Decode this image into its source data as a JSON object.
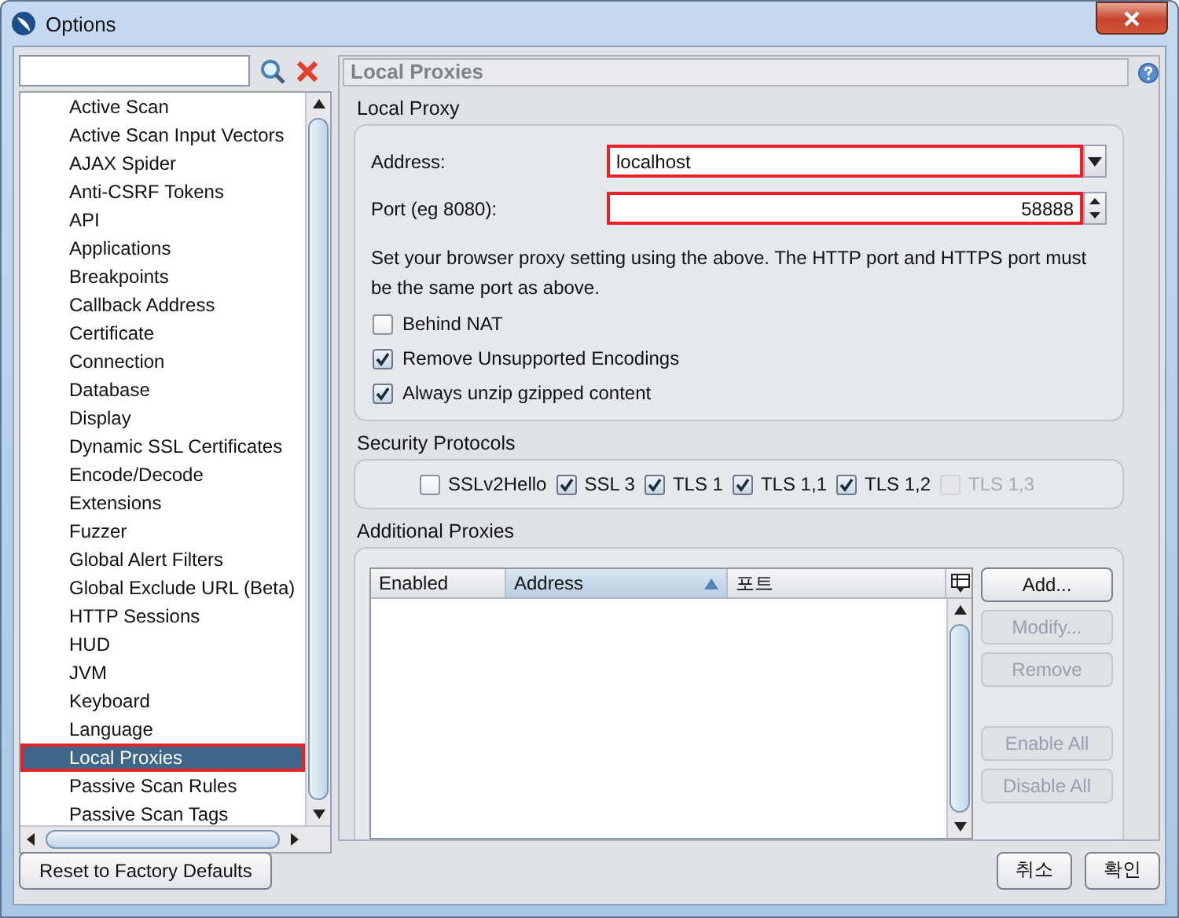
{
  "window": {
    "title": "Options"
  },
  "sidebar": {
    "items": [
      {
        "label": "Active Scan",
        "selected": false
      },
      {
        "label": "Active Scan Input Vectors",
        "selected": false
      },
      {
        "label": "AJAX Spider",
        "selected": false
      },
      {
        "label": "Anti-CSRF Tokens",
        "selected": false
      },
      {
        "label": "API",
        "selected": false
      },
      {
        "label": "Applications",
        "selected": false
      },
      {
        "label": "Breakpoints",
        "selected": false
      },
      {
        "label": "Callback Address",
        "selected": false
      },
      {
        "label": "Certificate",
        "selected": false
      },
      {
        "label": "Connection",
        "selected": false
      },
      {
        "label": "Database",
        "selected": false
      },
      {
        "label": "Display",
        "selected": false
      },
      {
        "label": "Dynamic SSL Certificates",
        "selected": false
      },
      {
        "label": "Encode/Decode",
        "selected": false
      },
      {
        "label": "Extensions",
        "selected": false
      },
      {
        "label": "Fuzzer",
        "selected": false
      },
      {
        "label": "Global Alert Filters",
        "selected": false
      },
      {
        "label": "Global Exclude URL (Beta)",
        "selected": false
      },
      {
        "label": "HTTP Sessions",
        "selected": false
      },
      {
        "label": "HUD",
        "selected": false
      },
      {
        "label": "JVM",
        "selected": false
      },
      {
        "label": "Keyboard",
        "selected": false
      },
      {
        "label": "Language",
        "selected": false
      },
      {
        "label": "Local Proxies",
        "selected": true,
        "highlighted": true
      },
      {
        "label": "Passive Scan Rules",
        "selected": false
      },
      {
        "label": "Passive Scan Tags",
        "selected": false
      }
    ]
  },
  "panel": {
    "title": "Local Proxies"
  },
  "local_proxy": {
    "title": "Local Proxy",
    "address": {
      "label": "Address:",
      "value": "localhost",
      "highlighted": true
    },
    "port": {
      "label": "Port (eg 8080):",
      "value": "58888",
      "highlighted": true
    },
    "note": "Set your browser proxy setting using the above.  The HTTP port and HTTPS port must be the same port as above.",
    "options": [
      {
        "label": "Behind NAT",
        "checked": false
      },
      {
        "label": "Remove Unsupported Encodings",
        "checked": true
      },
      {
        "label": "Always unzip gzipped content",
        "checked": true
      }
    ]
  },
  "security_protocols": {
    "title": "Security Protocols",
    "protocols": [
      {
        "label": "SSLv2Hello",
        "checked": false,
        "disabled": false
      },
      {
        "label": "SSL 3",
        "checked": true,
        "disabled": false
      },
      {
        "label": "TLS 1",
        "checked": true,
        "disabled": false
      },
      {
        "label": "TLS 1,1",
        "checked": true,
        "disabled": false
      },
      {
        "label": "TLS 1,2",
        "checked": true,
        "disabled": false
      },
      {
        "label": "TLS 1,3",
        "checked": false,
        "disabled": true
      }
    ]
  },
  "additional_proxies": {
    "title": "Additional Proxies",
    "columns": [
      {
        "label": "Enabled",
        "sorted": false
      },
      {
        "label": "Address",
        "sorted": true
      },
      {
        "label": "포트",
        "sorted": false
      }
    ],
    "buttons": [
      {
        "label": "Add...",
        "disabled": false
      },
      {
        "label": "Modify...",
        "disabled": true
      },
      {
        "label": "Remove",
        "disabled": true
      },
      {
        "label": "Enable All",
        "disabled": true
      },
      {
        "label": "Disable All",
        "disabled": true
      }
    ]
  },
  "footer": {
    "reset_button": "Reset to Factory Defaults",
    "buttons": [
      "취소",
      "확인"
    ]
  }
}
